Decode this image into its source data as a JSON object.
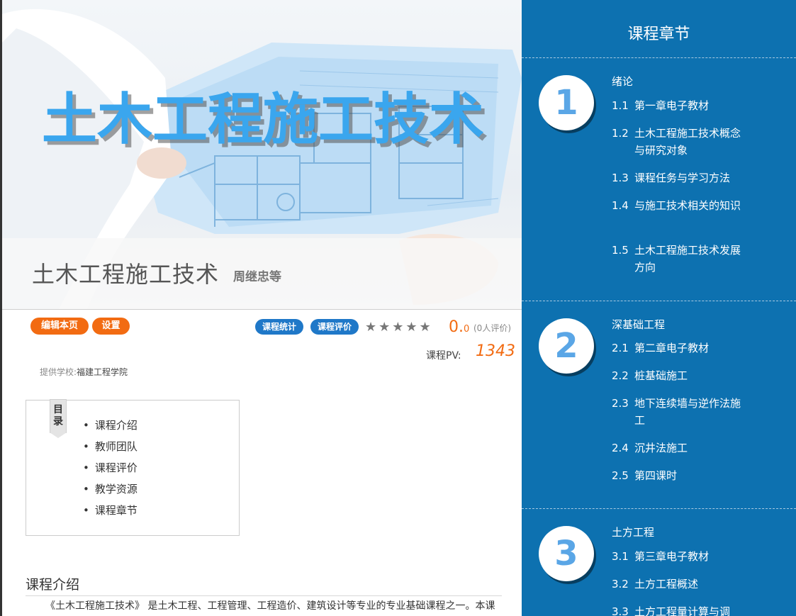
{
  "banner": {
    "hero_text": "土木工程施工技术",
    "course_name": "土木工程施工技术",
    "author": "周继忠等"
  },
  "actions": {
    "edit_label": "编辑本页",
    "settings_label": "设置",
    "stats_label": "课程统计",
    "review_label": "课程评价"
  },
  "rating": {
    "stars": "★★★★★",
    "score_int": "0.",
    "score_dec": "0",
    "count": "(0人评价)"
  },
  "pv": {
    "label": "课程PV:",
    "value": "1343"
  },
  "school": {
    "label": "提供学校:",
    "name": "福建工程学院"
  },
  "toc": {
    "tab": "目录",
    "items": [
      "课程介绍",
      "教师团队",
      "课程评价",
      "教学资源",
      "课程章节"
    ]
  },
  "intro": {
    "title": "课程介绍",
    "text": "《土木工程施工技术》 是土木工程、工程管理、工程造价、建筑设计等专业的专业基础课程之一。本课程"
  },
  "chapters_panel": {
    "title": "课程章节",
    "chapters": [
      {
        "number": "1",
        "title": "绪论",
        "sections": [
          {
            "num": "1.1",
            "text": "第一章电子教材"
          },
          {
            "num": "1.2",
            "text": "土木工程施工技术概念与研究对象"
          },
          {
            "num": "1.3",
            "text": "课程任务与学习方法"
          },
          {
            "num": "1.4",
            "text": "与施工技术相关的知识"
          },
          {
            "num": "1.5",
            "text": "土木工程施工技术发展方向"
          }
        ]
      },
      {
        "number": "2",
        "title": "深基础工程",
        "sections": [
          {
            "num": "2.1",
            "text": "第二章电子教材"
          },
          {
            "num": "2.2",
            "text": "桩基础施工"
          },
          {
            "num": "2.3",
            "text": "地下连续墙与逆作法施工"
          },
          {
            "num": "2.4",
            "text": "沉井法施工"
          },
          {
            "num": "2.5",
            "text": "第四课时"
          }
        ]
      },
      {
        "number": "3",
        "title": "土方工程",
        "sections": [
          {
            "num": "3.1",
            "text": "第三章电子教材"
          },
          {
            "num": "3.2",
            "text": "土方工程概述"
          },
          {
            "num": "3.3",
            "text": "土方工程量计算与调"
          }
        ]
      }
    ]
  },
  "colors": {
    "panel_bg": "#0d71b0",
    "accent_orange": "#f26b12",
    "accent_blue": "#1f78c8",
    "hero_blue": "#3aa6ee"
  }
}
